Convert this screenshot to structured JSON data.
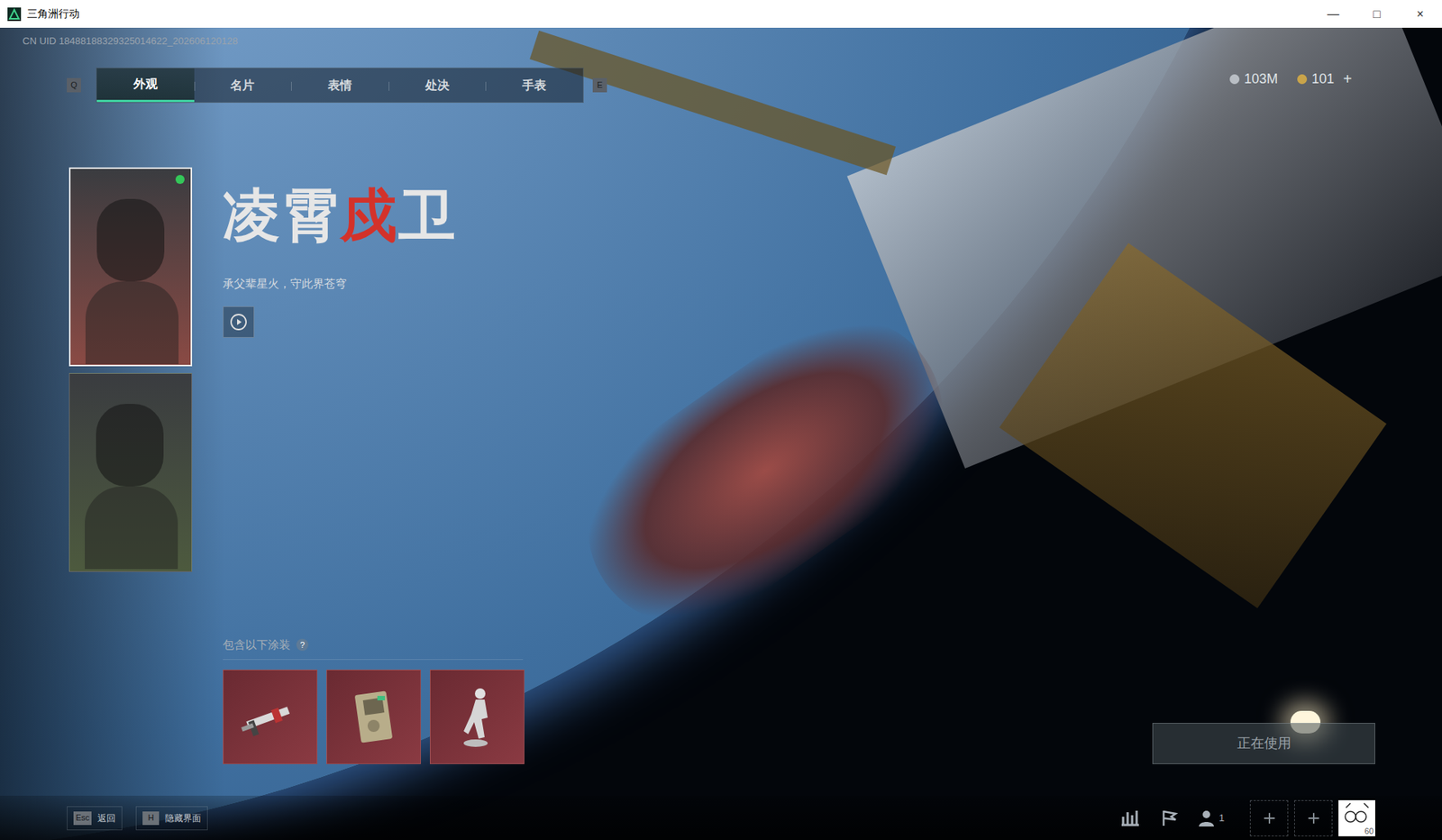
{
  "window": {
    "title": "三角洲行动",
    "controls": [
      "—",
      "□",
      "×"
    ]
  },
  "uid": "CN UID 18488188329325014622_202606120128",
  "tabs": {
    "prev_key": "Q",
    "next_key": "E",
    "items": [
      {
        "label": "外观",
        "selected": true
      },
      {
        "label": "名片",
        "selected": false
      },
      {
        "label": "表情",
        "selected": false
      },
      {
        "label": "处决",
        "selected": false
      },
      {
        "label": "手表",
        "selected": false
      }
    ]
  },
  "currency": [
    {
      "kind": "silver",
      "amount": "103M",
      "add": ""
    },
    {
      "kind": "gold",
      "amount": "101",
      "add": "+"
    }
  ],
  "operators": [
    {
      "selected": true,
      "online": true,
      "color": "#8a4a44"
    },
    {
      "selected": false,
      "online": false,
      "color": "#4d5a3e"
    }
  ],
  "skin": {
    "name_parts": [
      {
        "text": "凌霄",
        "color": "#e6e6e6"
      },
      {
        "text": "戍",
        "color": "#d3322a"
      },
      {
        "text": "卫",
        "color": "#e6e6e6"
      }
    ],
    "tagline": "承父辈星火，守此界苍穹"
  },
  "includes": {
    "label": "包含以下涂装",
    "help": "?",
    "items": [
      {
        "kind": "weapon"
      },
      {
        "kind": "device"
      },
      {
        "kind": "figure"
      }
    ]
  },
  "action": {
    "label": "正在使用",
    "disabled": true
  },
  "hints": [
    {
      "key": "Esc",
      "label": "返回"
    },
    {
      "key": "H",
      "label": "隐藏界面"
    }
  ],
  "footer": {
    "party_count": "1",
    "level": "60"
  }
}
